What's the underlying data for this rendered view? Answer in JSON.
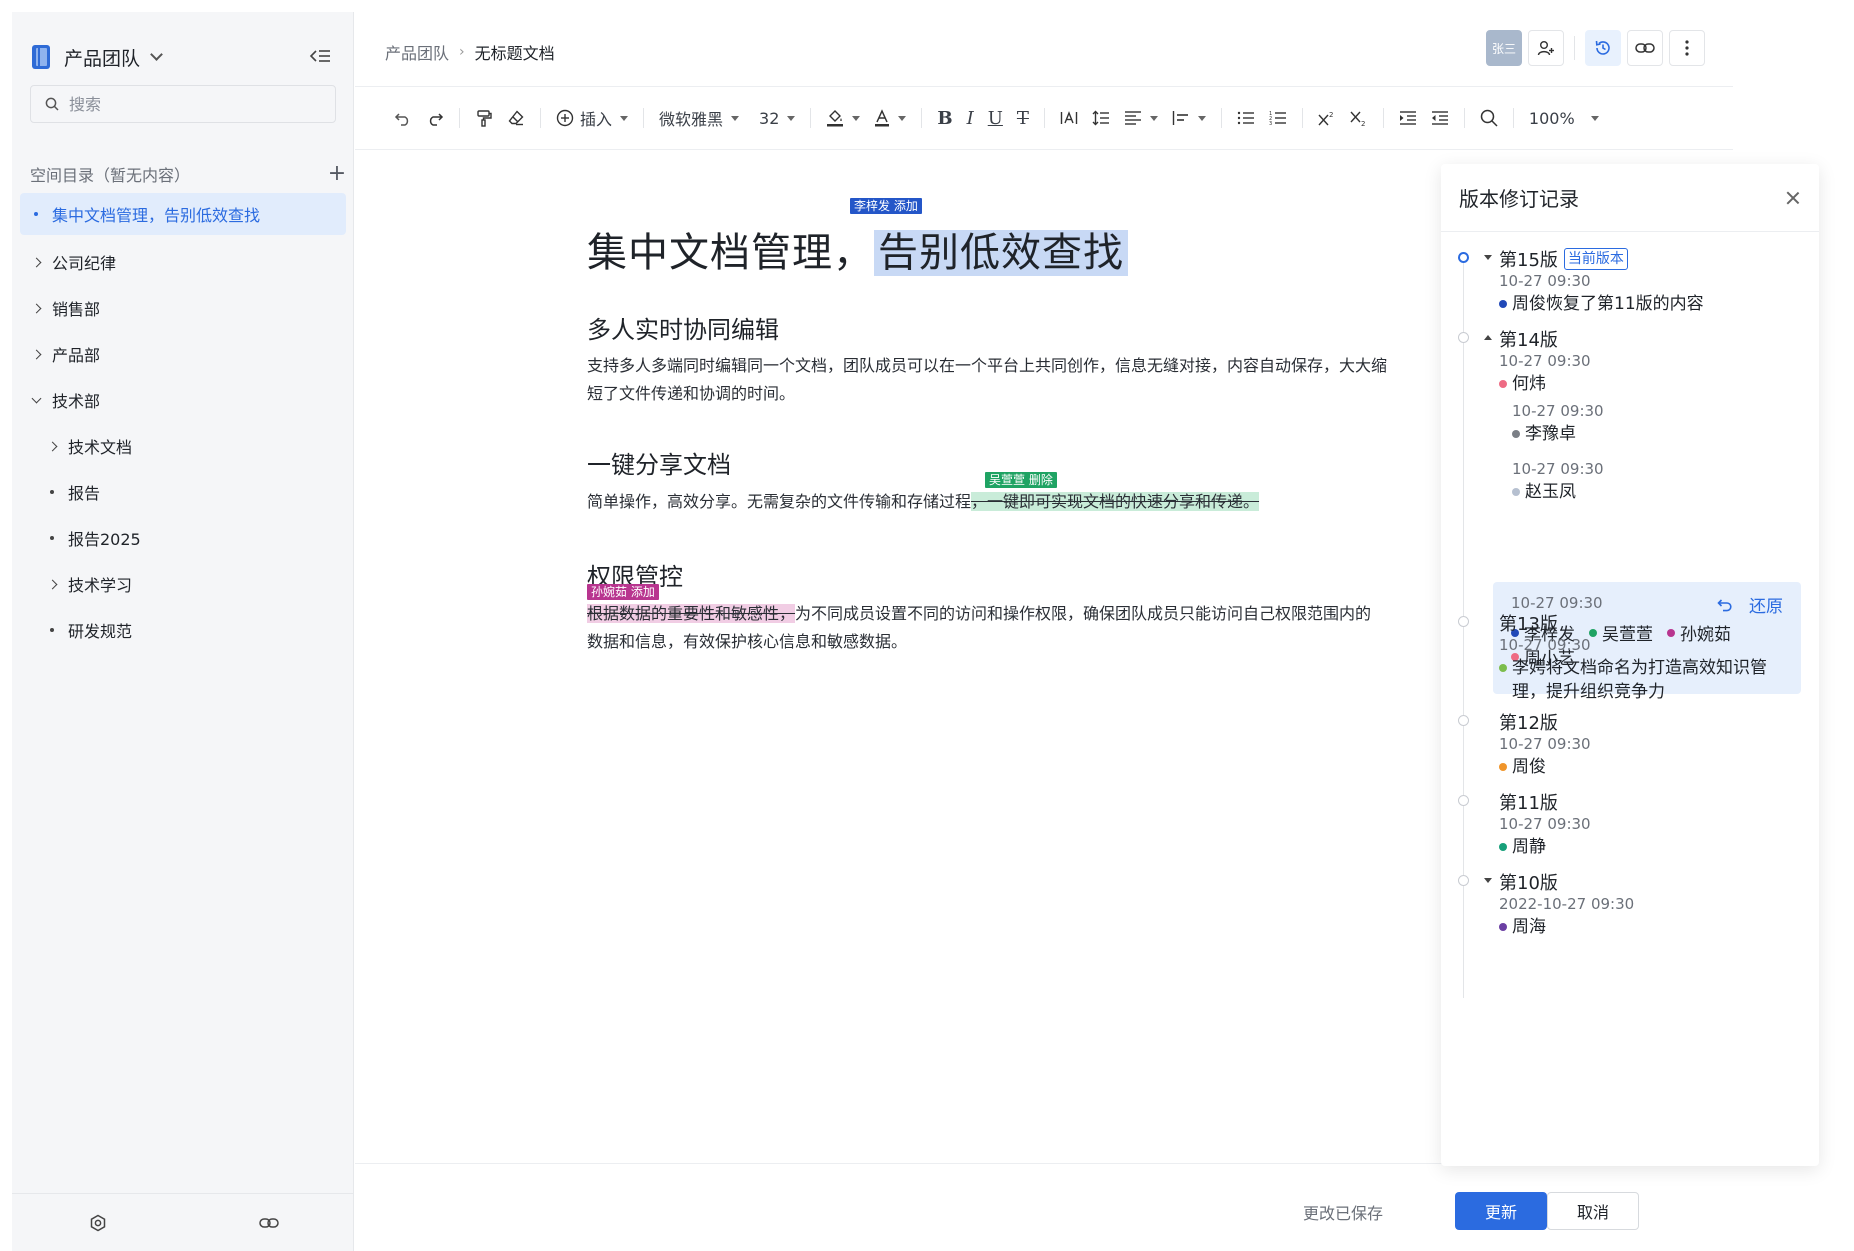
{
  "sidebar": {
    "team_name": "产品团队",
    "search_placeholder": "搜索",
    "dir_label": "空间目录（暂无内容）",
    "items": [
      {
        "label": "集中文档管理，告别低效查找",
        "type": "doc",
        "active": true
      },
      {
        "label": "公司纪律",
        "type": "folder"
      },
      {
        "label": "销售部",
        "type": "folder"
      },
      {
        "label": "产品部",
        "type": "folder"
      },
      {
        "label": "技术部",
        "type": "folder-open"
      },
      {
        "label": "技术文档",
        "type": "folder",
        "child": true
      },
      {
        "label": "报告",
        "type": "doc",
        "child": true
      },
      {
        "label": "报告2025",
        "type": "doc",
        "child": true
      },
      {
        "label": "技术学习",
        "type": "folder",
        "child": true
      },
      {
        "label": "研发规范",
        "type": "doc",
        "child": true
      }
    ]
  },
  "header": {
    "breadcrumb_root": "产品团队",
    "breadcrumb_sep": "›",
    "breadcrumb_current": "无标题文档",
    "avatar_text": "张三"
  },
  "toolbar": {
    "insert_label": "插入",
    "font_family": "微软雅黑",
    "font_size": "32",
    "zoom": "100%"
  },
  "document": {
    "title_plain": "集中文档管理，",
    "title_highlight": "告别低效查找",
    "title_tag": "李梓发 添加",
    "sections": [
      {
        "heading": "多人实时协同编辑",
        "body": "支持多人多端同时编辑同一个文档，团队成员可以在一个平台上共同创作，信息无缝对接，内容自动保存，大大缩短了文件传递和协调的时间。"
      },
      {
        "heading": "一键分享文档",
        "body_plain": "简单操作，高效分享。无需复杂的文件传输和存储过程",
        "body_deleted": "，一键即可实现文档的快速分享和传递。",
        "tag": "吴萱萱 删除"
      },
      {
        "heading": "权限管控",
        "body_highlight": "根据数据的重要性和敏感性，",
        "body_plain": "为不同成员设置不同的访问和操作权限，确保团队成员只能访问自己权限范围内的数据和信息，有效保护核心信息和敏感数据。",
        "tag": "孙婉茹 添加"
      }
    ],
    "tag_colors": {
      "blue": "#2456c8",
      "green": "#1fa363",
      "pink": "#b8358f"
    }
  },
  "footer": {
    "saved_text": "更改已保存",
    "update_label": "更新",
    "cancel_label": "取消"
  },
  "panel": {
    "title": "版本修订记录",
    "current_badge": "当前版本",
    "restore_label": "还原",
    "versions": [
      {
        "label": "第15版",
        "time": "10-27 09:30",
        "desc": "周俊恢复了第11版的内容",
        "dot": "#2149b8"
      },
      {
        "label": "第14版",
        "time": "10-27 09:30",
        "desc": "何炜",
        "dot": "#ee6b84"
      },
      {
        "label": "",
        "time": "10-27 09:30",
        "desc": "李豫卓",
        "dot": "#7b7f86"
      },
      {
        "label": "",
        "time": "10-27 09:30",
        "desc": "赵玉凤",
        "dot": "#b6c0d0"
      },
      {
        "label": "",
        "time": "10-27 09:30",
        "users": [
          {
            "name": "李梓发",
            "dot": "#2149b8"
          },
          {
            "name": "吴萱萱",
            "dot": "#1fa363"
          },
          {
            "name": "孙婉茹",
            "dot": "#b8358f"
          },
          {
            "name": "周小艺",
            "dot": "#ee6b84"
          }
        ]
      },
      {
        "label": "第13版",
        "time": "10-27 09:30",
        "desc": "李娉将文档命名为打造高效知识管理，提升组织竞争力",
        "dot": "#7cbd4c"
      },
      {
        "label": "第12版",
        "time": "10-27 09:30",
        "desc": "周俊",
        "dot": "#f0952a"
      },
      {
        "label": "第11版",
        "time": "10-27 09:30",
        "desc": "周静",
        "dot": "#17a07a"
      },
      {
        "label": "第10版",
        "time": "2022-10-27 09:30",
        "desc": "周海",
        "dot": "#6b3fa3"
      }
    ]
  }
}
